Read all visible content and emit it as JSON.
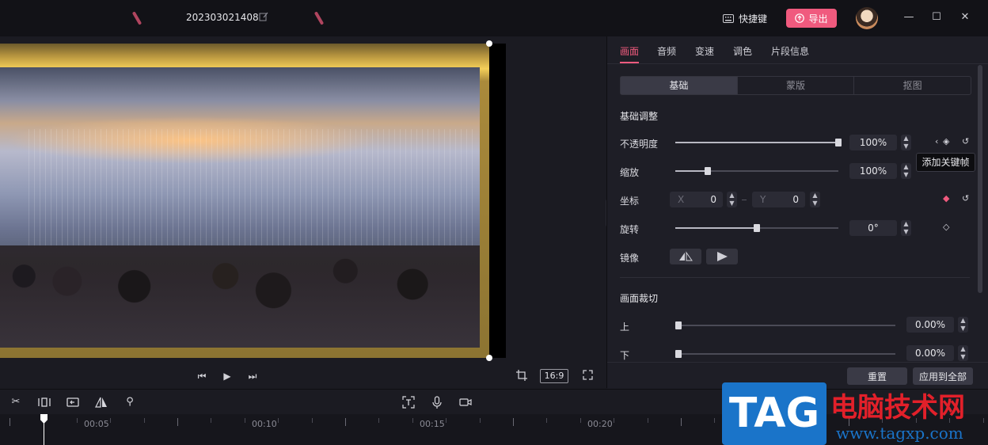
{
  "titlebar": {
    "project_name": "202303021408",
    "shortcut_label": "快捷键",
    "export_label": "导出"
  },
  "player": {
    "aspect_ratio": "16:9"
  },
  "panel": {
    "tabs": [
      "画面",
      "音频",
      "变速",
      "调色",
      "片段信息"
    ],
    "active_tab": "画面",
    "segments": [
      "基础",
      "蒙版",
      "抠图"
    ],
    "active_segment": "基础",
    "basic_section_title": "基础调整",
    "opacity": {
      "label": "不透明度",
      "value": "100%",
      "fraction": 1.0
    },
    "scale": {
      "label": "缩放",
      "value": "100%",
      "fraction": 0.2
    },
    "position": {
      "label": "坐标",
      "x_label": "X",
      "x_value": "0",
      "y_label": "Y",
      "y_value": "0"
    },
    "rotation": {
      "label": "旋转",
      "value": "0°",
      "fraction": 0.5
    },
    "mirror": {
      "label": "镜像"
    },
    "tooltip": "添加关键帧",
    "crop_section_title": "画面裁切",
    "crop_top": {
      "label": "上",
      "value": "0.00%"
    },
    "crop_bottom": {
      "label": "下",
      "value": "0.00%"
    },
    "reset_label": "重置",
    "apply_all_label": "应用到全部",
    "accent_color": "#f05a7e"
  },
  "timeline": {
    "labels": [
      "00:05",
      "00:10",
      "00:15",
      "00:20"
    ]
  },
  "watermark": {
    "tag": "TAG",
    "site_name": "电脑技术网",
    "url": "www.tagxp.com"
  }
}
